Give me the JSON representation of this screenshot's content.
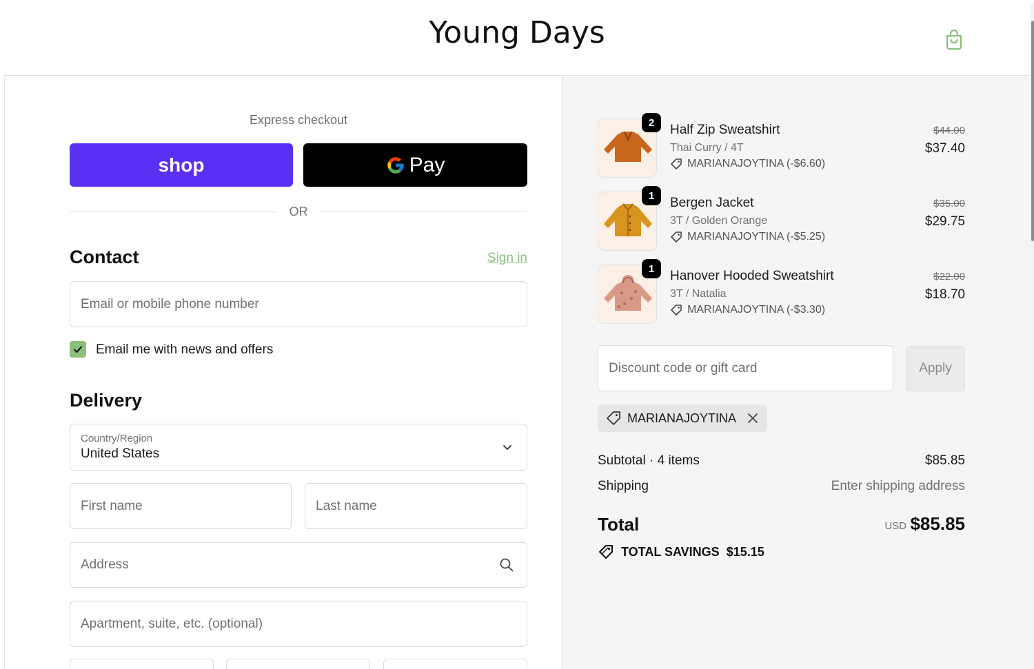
{
  "brand": {
    "name": "Young Days",
    "accent": "#8cbf7c",
    "shop_pay_color": "#5a31f4"
  },
  "express": {
    "title": "Express checkout",
    "shop_label": "shop",
    "gpay_label": "Pay",
    "or_label": "OR"
  },
  "contact": {
    "title": "Contact",
    "signin_label": "Sign in",
    "email_placeholder": "Email or mobile phone number",
    "newsletter_label": "Email me with news and offers",
    "newsletter_checked": true
  },
  "delivery": {
    "title": "Delivery",
    "country_label": "Country/Region",
    "country_value": "United States",
    "first_name_placeholder": "First name",
    "last_name_placeholder": "Last name",
    "address_placeholder": "Address",
    "apartment_placeholder": "Apartment, suite, etc. (optional)"
  },
  "cart": {
    "items": [
      {
        "name": "Half Zip Sweatshirt",
        "variant": "Thai Curry / 4T",
        "quantity": "2",
        "discount": "MARIANAJOYTINA (-$6.60)",
        "original_price": "$44.00",
        "price": "$37.40",
        "color": "#c8661c"
      },
      {
        "name": "Bergen Jacket",
        "variant": "3T / Golden Orange",
        "quantity": "1",
        "discount": "MARIANAJOYTINA (-$5.25)",
        "original_price": "$35.00",
        "price": "$29.75",
        "color": "#d99420"
      },
      {
        "name": "Hanover Hooded Sweatshirt",
        "variant": "3T / Natalia",
        "quantity": "1",
        "discount": "MARIANAJOYTINA (-$3.30)",
        "original_price": "$22.00",
        "price": "$18.70",
        "color": "#d79a86"
      }
    ],
    "discount_placeholder": "Discount code or gift card",
    "apply_label": "Apply",
    "applied_code": "MARIANAJOYTINA",
    "subtotal_label": "Subtotal · 4 items",
    "subtotal_value": "$85.85",
    "shipping_label": "Shipping",
    "shipping_value": "Enter shipping address",
    "total_label": "Total",
    "total_currency": "USD",
    "total_value": "$85.85",
    "savings_label": "TOTAL SAVINGS",
    "savings_value": "$15.15"
  }
}
